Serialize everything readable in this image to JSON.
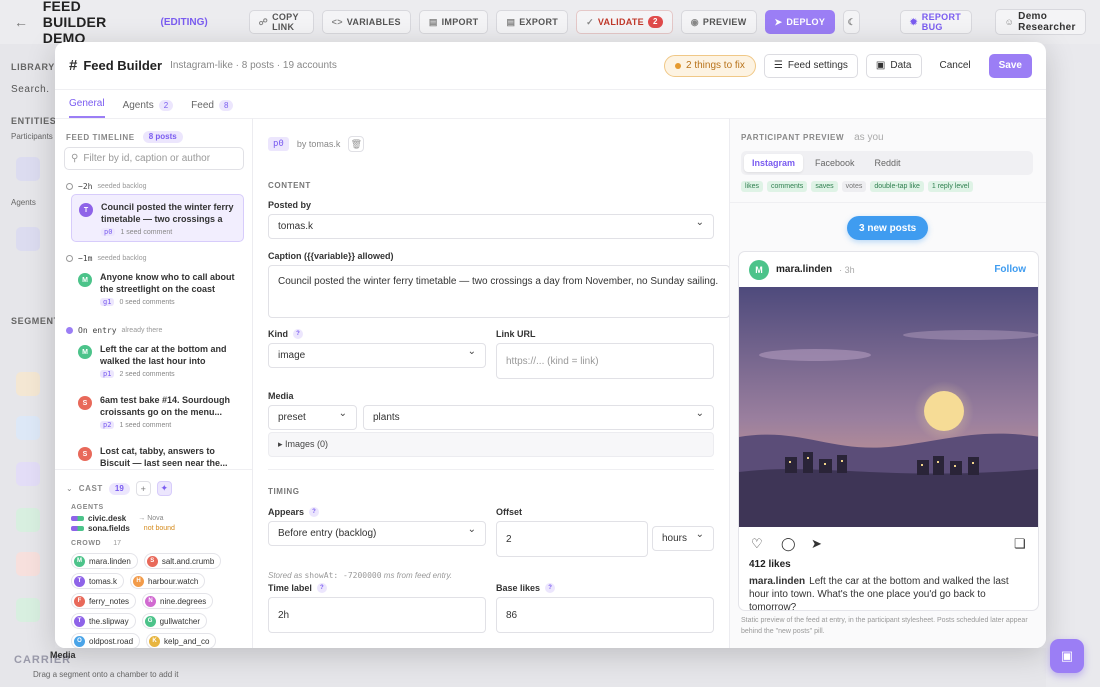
{
  "topbar": {
    "title": "FEED BUILDER DEMO",
    "status": "(EDITING)",
    "buttons": {
      "copy_link": "COPY LINK",
      "variables": "VARIABLES",
      "import": "IMPORT",
      "export": "EXPORT",
      "validate": "VALIDATE",
      "validate_count": "2",
      "preview": "PREVIEW",
      "deploy": "DEPLOY",
      "report_bug": "REPORT BUG"
    },
    "user": "Demo Researcher"
  },
  "background": {
    "library": "LIBRARY",
    "search": "Search.",
    "entities": "ENTITIES",
    "participants": "Participants",
    "agents": "Agents",
    "segments": "SEGMENTS",
    "drag_hint": "Drag a segment onto a chamber to add it",
    "media": "Media",
    "logo": "CARRIER"
  },
  "modal": {
    "title": "Feed Builder",
    "subtitle": "Instagram-like · 8 posts · 19 accounts",
    "fix_chip": "2 things to fix",
    "feed_settings": "Feed settings",
    "data": "Data",
    "cancel": "Cancel",
    "save": "Save",
    "tabs": [
      {
        "label": "General",
        "count": ""
      },
      {
        "label": "Agents",
        "count": "2"
      },
      {
        "label": "Feed",
        "count": "8"
      }
    ]
  },
  "timeline": {
    "label": "FEED TIMELINE",
    "count": "8 posts",
    "search_placeholder": "Filter by id, caption or author",
    "groups": [
      {
        "key": "−2h",
        "desc": "seeded backlog"
      },
      {
        "key": "−1m",
        "desc": "seeded backlog"
      },
      {
        "key": "On entry",
        "desc": "already there"
      }
    ],
    "posts": [
      {
        "initial": "T",
        "color": "#8e63e8",
        "text": "Council posted the winter ferry timetable — two crossings a d...",
        "id": "p0",
        "meta": "1 seed comment"
      },
      {
        "initial": "M",
        "color": "#4cc38a",
        "text": "Anyone know who to call about the streetlight on the coast roa...",
        "id": "g1",
        "meta": "0 seed comments"
      },
      {
        "initial": "M",
        "color": "#4cc38a",
        "text": "Left the car at the bottom and walked the last hour into town....",
        "id": "p1",
        "meta": "2 seed comments"
      },
      {
        "initial": "S",
        "color": "#e8695a",
        "text": "6am test bake #14. Sourdough croissants go on the menu...",
        "id": "p2",
        "meta": "1 seed comment"
      },
      {
        "initial": "S",
        "color": "#e8695a",
        "text": "Lost cat, tabby, answers to Biscuit — last seen near the...",
        "id": "",
        "meta": ""
      }
    ]
  },
  "cast": {
    "label": "CAST",
    "count": "19",
    "agents_label": "AGENTS",
    "agents": [
      {
        "name": "civic.desk",
        "target": "→ Nova",
        "note": ""
      },
      {
        "name": "sona.fields",
        "target": "",
        "note": "not bound"
      }
    ],
    "crowd_label": "CROWD",
    "crowd_count": "17",
    "crowd": [
      {
        "name": "mara.linden",
        "initial": "M",
        "color": "#4cc38a"
      },
      {
        "name": "salt.and.crumb",
        "initial": "S",
        "color": "#e8695a"
      },
      {
        "name": "tomas.k",
        "initial": "T",
        "color": "#8e63e8"
      },
      {
        "name": "harbour.watch",
        "initial": "H",
        "color": "#f29b4a"
      },
      {
        "name": "ferry_notes",
        "initial": "F",
        "color": "#e8695a"
      },
      {
        "name": "nine.degrees",
        "initial": "N",
        "color": "#d16ad1"
      },
      {
        "name": "the.slipway",
        "initial": "T",
        "color": "#8e63e8"
      },
      {
        "name": "gullwatcher",
        "initial": "G",
        "color": "#4cc38a"
      },
      {
        "name": "oldpost.road",
        "initial": "O",
        "color": "#4aa4e8"
      },
      {
        "name": "kelp_and_co",
        "initial": "K",
        "color": "#e8b53f"
      }
    ]
  },
  "editor": {
    "post_id": "p0",
    "by": "by tomas.k",
    "content_label": "CONTENT",
    "posted_by_label": "Posted by",
    "posted_by": "tomas.k",
    "caption_label": "Caption ({{variable}} allowed)",
    "caption": "Council posted the winter ferry timetable — two crossings a day from November, no Sunday sailing.",
    "kind_label": "Kind",
    "kind": "image",
    "link_label": "Link URL",
    "link_placeholder": "https://... (kind = link)",
    "media_label": "Media",
    "media_source": "preset",
    "media_preset": "plants",
    "images_toggle": "▸ Images (0)",
    "timing_label": "TIMING",
    "appears_label": "Appears",
    "appears": "Before entry (backlog)",
    "offset_label": "Offset",
    "offset": "2",
    "offset_unit": "hours",
    "stored_note_prefix": "Stored as",
    "stored_note_code": "showAt: -7200000",
    "stored_note_suffix": "ms from feed entry.",
    "time_label_label": "Time label",
    "time_label": "2h",
    "base_likes_label": "Base likes",
    "base_likes": "86"
  },
  "preview": {
    "label": "PARTICIPANT PREVIEW",
    "as_you": "as you",
    "tabs": [
      "Instagram",
      "Facebook",
      "Reddit"
    ],
    "capabilities": [
      {
        "label": "likes",
        "on": true
      },
      {
        "label": "comments",
        "on": true
      },
      {
        "label": "saves",
        "on": true
      },
      {
        "label": "votes",
        "on": false
      },
      {
        "label": "double-tap like",
        "on": true
      },
      {
        "label": "1 reply level",
        "on": true
      }
    ],
    "new_posts": "3 new posts",
    "card": {
      "avatar": "M",
      "author": "mara.linden",
      "time": "· 3h",
      "follow": "Follow",
      "likes": "412 likes",
      "caption_author": "mara.linden",
      "caption": "Left the car at the bottom and walked the last hour into town. What's the one place you'd go back to tomorrow?"
    },
    "footnote": "Static preview of the feed at entry, in the participant stylesheet. Posts scheduled later appear behind the \"new posts\" pill."
  },
  "colors": {
    "accent": "#9b7ef5",
    "link": "#3f9cf0",
    "warning": "#e59a2f"
  }
}
